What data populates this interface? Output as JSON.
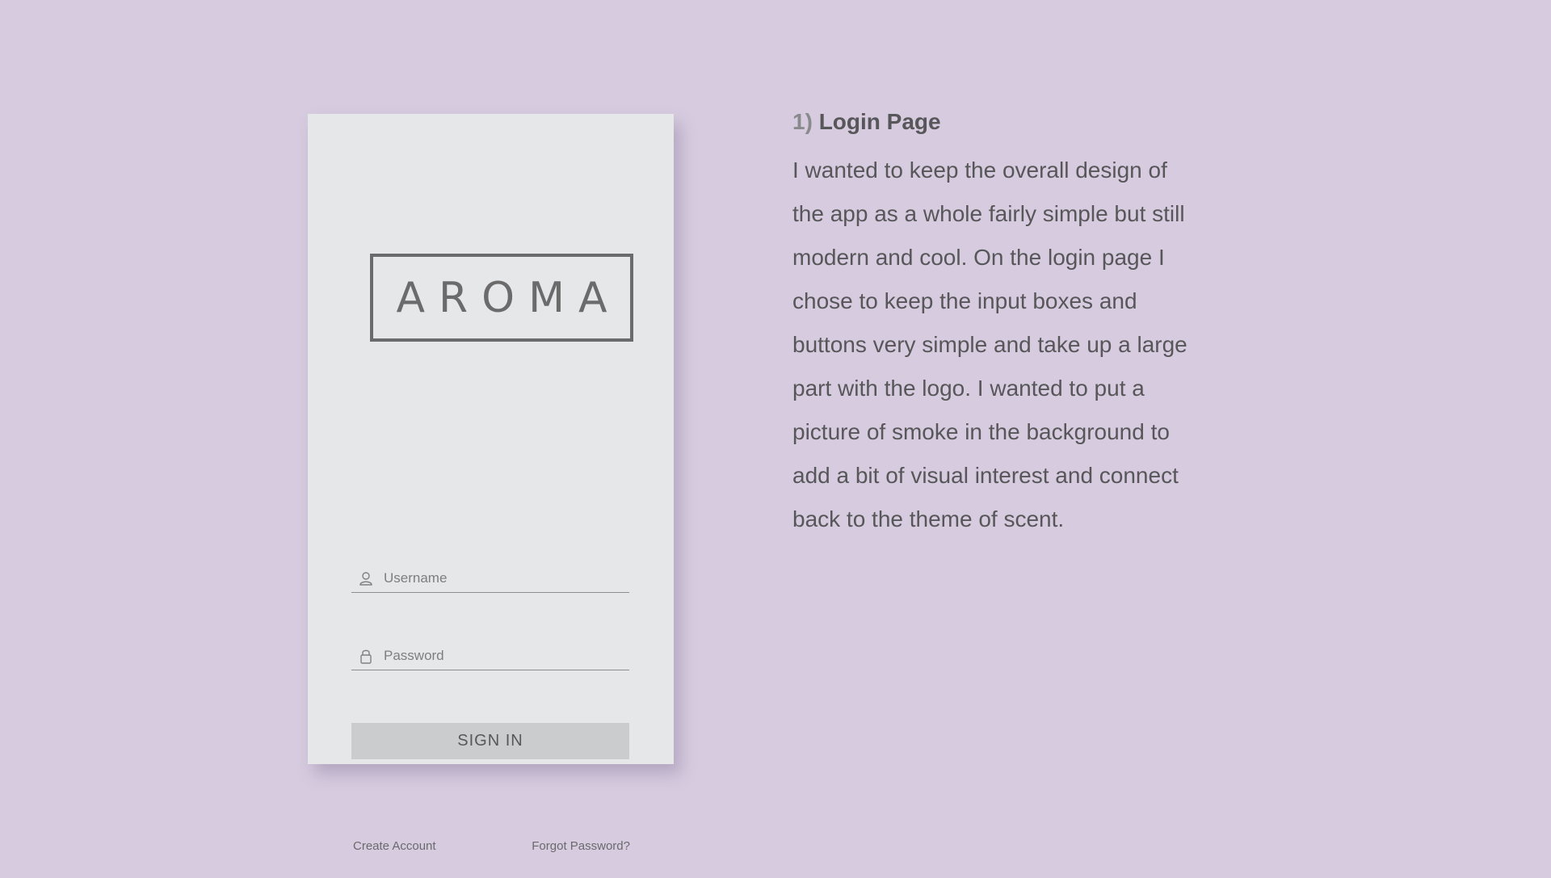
{
  "login_screen": {
    "logo": "AROMA",
    "username": {
      "placeholder": "Username",
      "icon": "user-icon"
    },
    "password": {
      "placeholder": "Password",
      "icon": "lock-icon"
    },
    "signin_label": "SIGN IN",
    "create_account": "Create Account",
    "forgot_password": "Forgot Password?"
  },
  "description": {
    "heading_number": "1)",
    "heading_title": "Login Page",
    "lines": [
      "I wanted to keep the overall design of",
      "the app as a whole fairly simple but still",
      "modern and cool. On the login page I",
      "chose to keep the input boxes and",
      "buttons very simple and take up a large",
      "part with the logo. I wanted to put a",
      "picture of smoke in the background to",
      "add a bit of visual interest and connect",
      "back to the theme of scent."
    ]
  },
  "colors": {
    "background": "#d6cbdf",
    "card": "#e6e7e9",
    "button": "#cbcccd",
    "text": "#575659"
  }
}
